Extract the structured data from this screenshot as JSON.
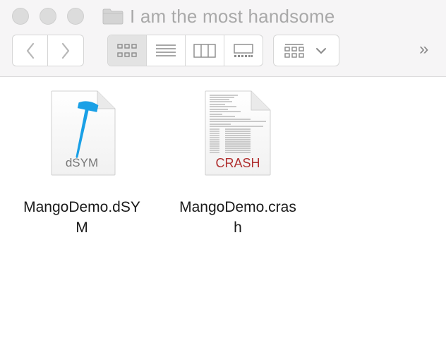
{
  "window": {
    "title": "I am the most handsome"
  },
  "toolbar": {
    "back_icon": "chevron-left-icon",
    "forward_icon": "chevron-right-icon",
    "view_modes": [
      {
        "name": "icon-view",
        "icon": "grid-icon",
        "active": true
      },
      {
        "name": "list-view",
        "icon": "list-icon",
        "active": false
      },
      {
        "name": "column-view",
        "icon": "columns-icon",
        "active": false
      },
      {
        "name": "gallery-view",
        "icon": "gallery-icon",
        "active": false
      }
    ],
    "group_icon": "group-grid-icon",
    "overflow_label": "»"
  },
  "files": [
    {
      "name_line1": "MangoDemo.dSY",
      "name_line2": "M",
      "badge": "dSYM",
      "icon": "dsym-file-icon"
    },
    {
      "name_line1": "MangoDemo.cras",
      "name_line2": "h",
      "badge": "CRASH",
      "icon": "crash-file-icon"
    }
  ],
  "colors": {
    "hammer": "#1aa0e6",
    "crash_red": "#b03030",
    "title_gray": "#a9a9a9"
  }
}
